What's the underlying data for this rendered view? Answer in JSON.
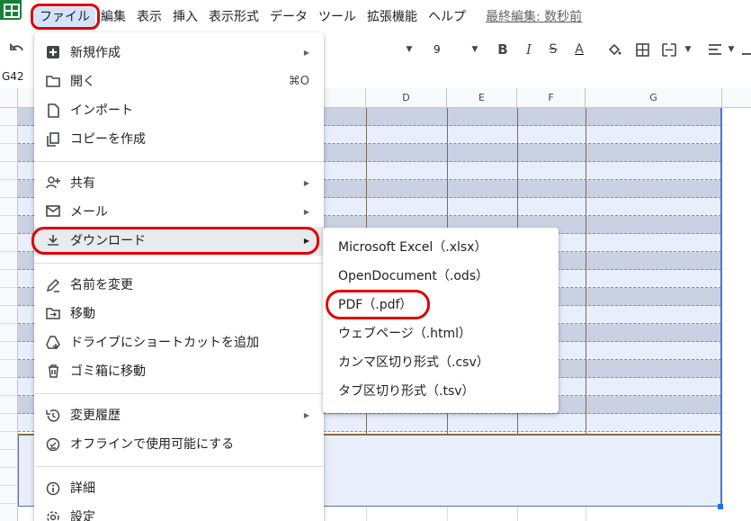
{
  "menubar": {
    "items": [
      "ファイル",
      "編集",
      "表示",
      "挿入",
      "表示形式",
      "データ",
      "ツール",
      "拡張機能",
      "ヘルプ"
    ],
    "last_edit": "最終編集: 数秒前"
  },
  "toolbar": {
    "font_size": "9",
    "bold": "B",
    "italic": "I",
    "strike": "S",
    "text_color": "A"
  },
  "name_box": "G42",
  "columns": [
    "D",
    "E",
    "F",
    "G"
  ],
  "file_menu": {
    "items": [
      {
        "label": "新規作成",
        "icon": "plus-box-icon",
        "submenu": true
      },
      {
        "label": "開く",
        "icon": "folder-icon",
        "shortcut": "⌘O"
      },
      {
        "label": "インポート",
        "icon": "file-icon"
      },
      {
        "label": "コピーを作成",
        "icon": "copy-icon"
      },
      {
        "label": "共有",
        "icon": "person-add-icon",
        "submenu": true
      },
      {
        "label": "メール",
        "icon": "mail-icon",
        "submenu": true
      },
      {
        "label": "ダウンロード",
        "icon": "download-icon",
        "submenu": true
      },
      {
        "label": "名前を変更",
        "icon": "rename-icon"
      },
      {
        "label": "移動",
        "icon": "move-folder-icon"
      },
      {
        "label": "ドライブにショートカットを追加",
        "icon": "drive-shortcut-icon"
      },
      {
        "label": "ゴミ箱に移動",
        "icon": "trash-icon"
      },
      {
        "label": "変更履歴",
        "icon": "history-icon",
        "submenu": true
      },
      {
        "label": "オフラインで使用可能にする",
        "icon": "offline-icon"
      },
      {
        "label": "詳細",
        "icon": "info-icon"
      },
      {
        "label": "設定",
        "icon": "settings-icon"
      }
    ]
  },
  "download_submenu": {
    "items": [
      "Microsoft Excel（.xlsx）",
      "OpenDocument（.ods）",
      "PDF（.pdf）",
      "ウェブページ（.html）",
      "カンマ区切り形式（.csv）",
      "タブ区切り形式（.tsv）"
    ]
  },
  "colors": {
    "highlight_ring": "#e00000",
    "band_dark": "#c9d1e3",
    "band_light": "#e8eefb",
    "active_menu": "#d3e3fd"
  }
}
